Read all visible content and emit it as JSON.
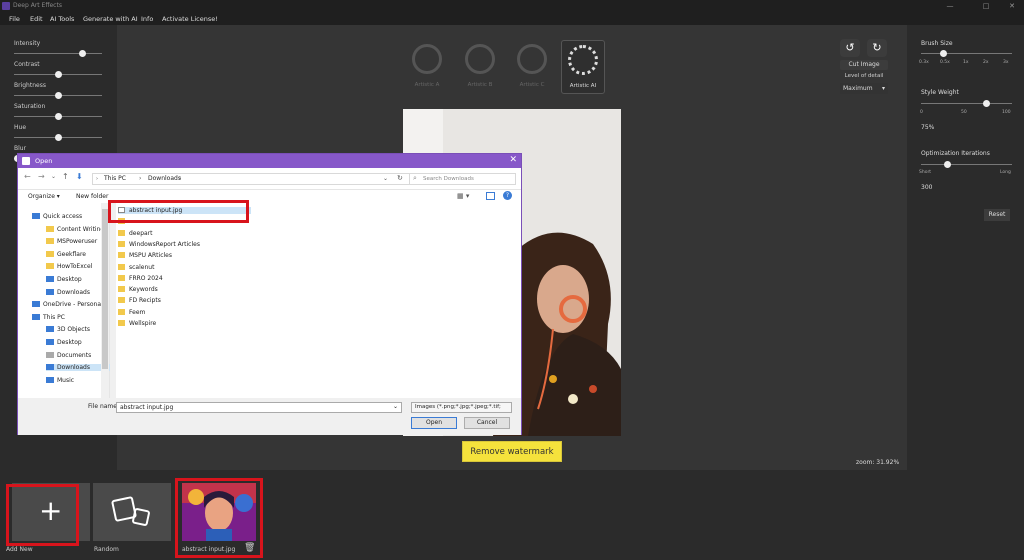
{
  "window": {
    "title": "Deep Art Effects",
    "min": "—",
    "max": "□",
    "close": "✕"
  },
  "menu": [
    "File",
    "Edit",
    "AI Tools",
    "Generate with AI",
    "Info",
    "Activate License!"
  ],
  "left_sliders": [
    {
      "label": "Intensity",
      "value": 0.8
    },
    {
      "label": "Contrast",
      "value": 0.5
    },
    {
      "label": "Brightness",
      "value": 0.5
    },
    {
      "label": "Saturation",
      "value": 0.5
    },
    {
      "label": "Hue",
      "value": 0.5
    },
    {
      "label": "Blur",
      "value": 0.0
    }
  ],
  "modes": [
    {
      "label": "Artistic A"
    },
    {
      "label": "Artistic B"
    },
    {
      "label": "Artistic C"
    },
    {
      "label": "Artistic AI"
    }
  ],
  "cut": {
    "label": "Cut Image",
    "lod_label": "Level of detail",
    "lod_value": "Maximum"
  },
  "right_panel": {
    "brush_size": {
      "label": "Brush Size",
      "ticks": [
        "0.3x",
        "0.5x",
        "1x",
        "2x",
        "3x"
      ]
    },
    "style_weight": {
      "label": "Style Weight",
      "ticks": [
        "0",
        "50",
        "100"
      ],
      "value": "75%"
    },
    "optimization": {
      "label": "Optimization Iterations",
      "ticks": [
        "Short",
        "Long"
      ],
      "value": "300"
    },
    "reset": "Reset"
  },
  "watermark_button": "Remove watermark",
  "zoom": "zoom: 31.92%",
  "thumbnails": [
    {
      "label": "Add New"
    },
    {
      "label": "Random"
    },
    {
      "label": "abstract input.jpg"
    }
  ],
  "dialog": {
    "title": "Open",
    "path": [
      "This PC",
      "Downloads"
    ],
    "search_placeholder": "Search Downloads",
    "toolbar": {
      "organize": "Organize ▾",
      "new_folder": "New folder"
    },
    "nav": [
      {
        "label": "Quick access",
        "kind": "star"
      },
      {
        "label": "Content Writing",
        "kind": "folder"
      },
      {
        "label": "MSPoweruser",
        "kind": "folder"
      },
      {
        "label": "Geekflare",
        "kind": "folder"
      },
      {
        "label": "HowToExcel",
        "kind": "folder"
      },
      {
        "label": "Desktop",
        "kind": "desktop"
      },
      {
        "label": "Downloads",
        "kind": "download"
      },
      {
        "label": "OneDrive - Personal",
        "kind": "cloud"
      },
      {
        "label": "This PC",
        "kind": "pc"
      },
      {
        "label": "3D Objects",
        "kind": "obj"
      },
      {
        "label": "Desktop",
        "kind": "desktop"
      },
      {
        "label": "Documents",
        "kind": "doc"
      },
      {
        "label": "Downloads",
        "kind": "download"
      },
      {
        "label": "Music",
        "kind": "music"
      }
    ],
    "files": [
      {
        "label": "abstract input.jpg",
        "kind": "image"
      },
      {
        "label": "",
        "kind": "folder"
      },
      {
        "label": "deepart",
        "kind": "folder"
      },
      {
        "label": "WindowsReport Articles",
        "kind": "folder"
      },
      {
        "label": "MSPU ARticles",
        "kind": "folder"
      },
      {
        "label": "scalenut",
        "kind": "folder"
      },
      {
        "label": "FRRO 2024",
        "kind": "folder"
      },
      {
        "label": "Keywords",
        "kind": "folder"
      },
      {
        "label": "FD Recipts",
        "kind": "folder"
      },
      {
        "label": "Feem",
        "kind": "folder"
      },
      {
        "label": "Wellspire",
        "kind": "folder"
      }
    ],
    "filename_label": "File name:",
    "filename_value": "abstract input.jpg",
    "filter": "Images (*.png;*.jpg;*.jpeg;*.tif;",
    "open": "Open",
    "cancel": "Cancel"
  }
}
